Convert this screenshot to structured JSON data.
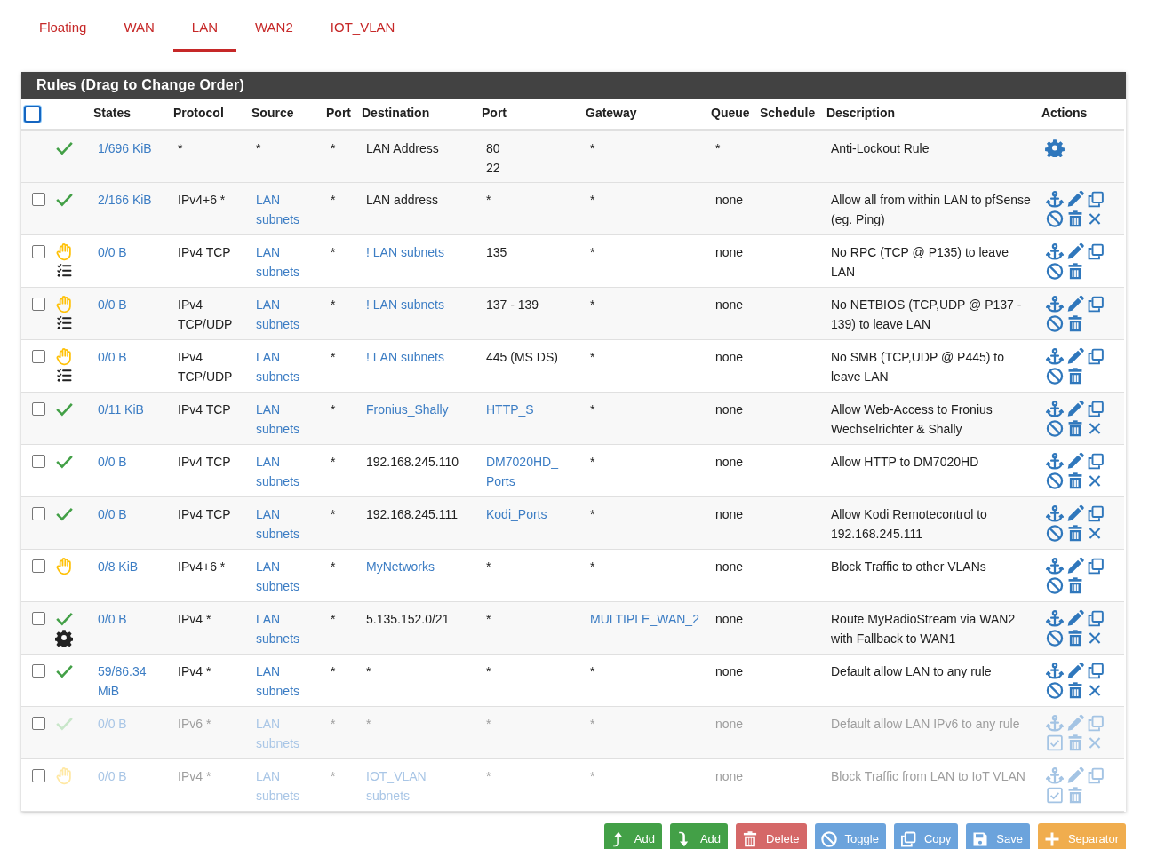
{
  "tabs": [
    {
      "label": "Floating",
      "selected": false
    },
    {
      "label": "WAN",
      "selected": false
    },
    {
      "label": "LAN",
      "selected": true
    },
    {
      "label": "WAN2",
      "selected": false
    },
    {
      "label": "IOT_VLAN",
      "selected": false
    }
  ],
  "panel": {
    "title": "Rules (Drag to Change Order)"
  },
  "table": {
    "select_all": {
      "checked": false
    },
    "columns": [
      "States",
      "Protocol",
      "Source",
      "Port",
      "Destination",
      "Port",
      "Gateway",
      "Queue",
      "Schedule",
      "Description",
      "Actions"
    ],
    "rows": [
      {
        "kind": "anti_lockout",
        "blocked": false,
        "enabled": true,
        "states": "1/696 KiB",
        "protocol": "*",
        "source": {
          "text": "*",
          "link": false
        },
        "source_port": "*",
        "destination": {
          "text": "LAN Address",
          "link": false
        },
        "destination_port": {
          "values": [
            "80",
            "22"
          ],
          "link": false
        },
        "gateway": {
          "text": "*",
          "link": false
        },
        "queue": "*",
        "description": "Anti-Lockout Rule"
      },
      {
        "kind": "rule",
        "checked": false,
        "blocked": false,
        "enabled": true,
        "logged": false,
        "advanced": false,
        "clear_states": true,
        "states": "2/166 KiB",
        "protocol": "IPv4+6 *",
        "source": {
          "text": "LAN subnets",
          "link": true
        },
        "source_port": "*",
        "destination": {
          "text": "LAN address",
          "link": false
        },
        "destination_port": {
          "values": [
            "*"
          ],
          "link": false
        },
        "gateway": {
          "text": "*",
          "link": false
        },
        "queue": "none",
        "description": "Allow all from within LAN to pfSense (eg. Ping)"
      },
      {
        "kind": "rule",
        "checked": false,
        "blocked": true,
        "enabled": true,
        "logged": true,
        "advanced": false,
        "clear_states": false,
        "states": "0/0 B",
        "protocol": "IPv4 TCP",
        "source": {
          "text": "LAN subnets",
          "link": true
        },
        "source_port": "*",
        "destination": {
          "text": "! LAN subnets",
          "link": true
        },
        "destination_port": {
          "values": [
            "135"
          ],
          "link": false
        },
        "gateway": {
          "text": "*",
          "link": false
        },
        "queue": "none",
        "description": "No RPC (TCP @ P135) to leave LAN"
      },
      {
        "kind": "rule",
        "checked": false,
        "blocked": true,
        "enabled": true,
        "logged": true,
        "advanced": false,
        "clear_states": false,
        "states": "0/0 B",
        "protocol": "IPv4 TCP/UDP",
        "source": {
          "text": "LAN subnets",
          "link": true
        },
        "source_port": "*",
        "destination": {
          "text": "! LAN subnets",
          "link": true
        },
        "destination_port": {
          "values": [
            "137 - 139"
          ],
          "link": false
        },
        "gateway": {
          "text": "*",
          "link": false
        },
        "queue": "none",
        "description": "No NETBIOS (TCP,UDP @ P137 - 139) to leave LAN"
      },
      {
        "kind": "rule",
        "checked": false,
        "blocked": true,
        "enabled": true,
        "logged": true,
        "advanced": false,
        "clear_states": false,
        "states": "0/0 B",
        "protocol": "IPv4 TCP/UDP",
        "source": {
          "text": "LAN subnets",
          "link": true
        },
        "source_port": "*",
        "destination": {
          "text": "! LAN subnets",
          "link": true
        },
        "destination_port": {
          "values": [
            "445 (MS DS)"
          ],
          "link": false
        },
        "gateway": {
          "text": "*",
          "link": false
        },
        "queue": "none",
        "description": "No SMB (TCP,UDP @ P445) to leave LAN"
      },
      {
        "kind": "rule",
        "checked": false,
        "blocked": false,
        "enabled": true,
        "logged": false,
        "advanced": false,
        "clear_states": true,
        "states": "0/11 KiB",
        "protocol": "IPv4 TCP",
        "source": {
          "text": "LAN subnets",
          "link": true
        },
        "source_port": "*",
        "destination": {
          "text": "Fronius_Shally",
          "link": true
        },
        "destination_port": {
          "values": [
            "HTTP_S"
          ],
          "link": true
        },
        "gateway": {
          "text": "*",
          "link": false
        },
        "queue": "none",
        "description": "Allow Web-Access to Fronius Wechselrichter & Shally"
      },
      {
        "kind": "rule",
        "checked": false,
        "blocked": false,
        "enabled": true,
        "logged": false,
        "advanced": false,
        "clear_states": true,
        "states": "0/0 B",
        "protocol": "IPv4 TCP",
        "source": {
          "text": "LAN subnets",
          "link": true
        },
        "source_port": "*",
        "destination": {
          "text": "192.168.245.110",
          "link": false
        },
        "destination_port": {
          "values": [
            "DM7020HD_Ports"
          ],
          "link": true
        },
        "gateway": {
          "text": "*",
          "link": false
        },
        "queue": "none",
        "description": "Allow HTTP to DM7020HD"
      },
      {
        "kind": "rule",
        "checked": false,
        "blocked": false,
        "enabled": true,
        "logged": false,
        "advanced": false,
        "clear_states": true,
        "states": "0/0 B",
        "protocol": "IPv4 TCP",
        "source": {
          "text": "LAN subnets",
          "link": true
        },
        "source_port": "*",
        "destination": {
          "text": "192.168.245.111",
          "link": false
        },
        "destination_port": {
          "values": [
            "Kodi_Ports"
          ],
          "link": true
        },
        "gateway": {
          "text": "*",
          "link": false
        },
        "queue": "none",
        "description": "Allow Kodi Remotecontrol to 192.168.245.111"
      },
      {
        "kind": "rule",
        "checked": false,
        "blocked": true,
        "enabled": true,
        "logged": false,
        "advanced": false,
        "clear_states": false,
        "states": "0/8 KiB",
        "protocol": "IPv4+6 *",
        "source": {
          "text": "LAN subnets",
          "link": true
        },
        "source_port": "*",
        "destination": {
          "text": "MyNetworks",
          "link": true
        },
        "destination_port": {
          "values": [
            "*"
          ],
          "link": false
        },
        "gateway": {
          "text": "*",
          "link": false
        },
        "queue": "none",
        "description": "Block Traffic to other VLANs"
      },
      {
        "kind": "rule",
        "checked": false,
        "blocked": false,
        "enabled": true,
        "logged": false,
        "advanced": true,
        "clear_states": true,
        "states": "0/0 B",
        "protocol": "IPv4 *",
        "source": {
          "text": "LAN subnets",
          "link": true
        },
        "source_port": "*",
        "destination": {
          "text": "5.135.152.0/21",
          "link": false
        },
        "destination_port": {
          "values": [
            "*"
          ],
          "link": false
        },
        "gateway": {
          "text": "MULTIPLE_WAN_2",
          "link": true
        },
        "queue": "none",
        "description": "Route MyRadioStream via WAN2 with Fallback to WAN1"
      },
      {
        "kind": "rule",
        "checked": false,
        "blocked": false,
        "enabled": true,
        "logged": false,
        "advanced": false,
        "clear_states": true,
        "states": "59/86.34 MiB",
        "protocol": "IPv4 *",
        "source": {
          "text": "LAN subnets",
          "link": true
        },
        "source_port": "*",
        "destination": {
          "text": "*",
          "link": false
        },
        "destination_port": {
          "values": [
            "*"
          ],
          "link": false
        },
        "gateway": {
          "text": "*",
          "link": false
        },
        "queue": "none",
        "description": "Default allow LAN to any rule"
      },
      {
        "kind": "rule",
        "checked": false,
        "blocked": false,
        "enabled": false,
        "logged": false,
        "advanced": false,
        "clear_states": true,
        "states": "0/0 B",
        "protocol": "IPv6 *",
        "source": {
          "text": "LAN subnets",
          "link": true
        },
        "source_port": "*",
        "destination": {
          "text": "*",
          "link": false
        },
        "destination_port": {
          "values": [
            "*"
          ],
          "link": false
        },
        "gateway": {
          "text": "*",
          "link": false
        },
        "queue": "none",
        "description": "Default allow LAN IPv6 to any rule"
      },
      {
        "kind": "rule",
        "checked": false,
        "blocked": true,
        "enabled": false,
        "logged": false,
        "advanced": false,
        "clear_states": false,
        "states": "0/0 B",
        "protocol": "IPv4 *",
        "source": {
          "text": "LAN subnets",
          "link": true
        },
        "source_port": "*",
        "destination": {
          "text": "IOT_VLAN subnets",
          "link": true
        },
        "destination_port": {
          "values": [
            "*"
          ],
          "link": false
        },
        "gateway": {
          "text": "*",
          "link": false
        },
        "queue": "none",
        "description": "Block Traffic from LAN to IoT VLAN"
      }
    ]
  },
  "buttons": [
    {
      "kind": "add_top",
      "label": "Add"
    },
    {
      "kind": "add_bottom",
      "label": "Add"
    },
    {
      "kind": "delete",
      "label": "Delete"
    },
    {
      "kind": "toggle",
      "label": "Toggle"
    },
    {
      "kind": "copy",
      "label": "Copy"
    },
    {
      "kind": "save",
      "label": "Save"
    },
    {
      "kind": "separator",
      "label": "Separator"
    }
  ]
}
